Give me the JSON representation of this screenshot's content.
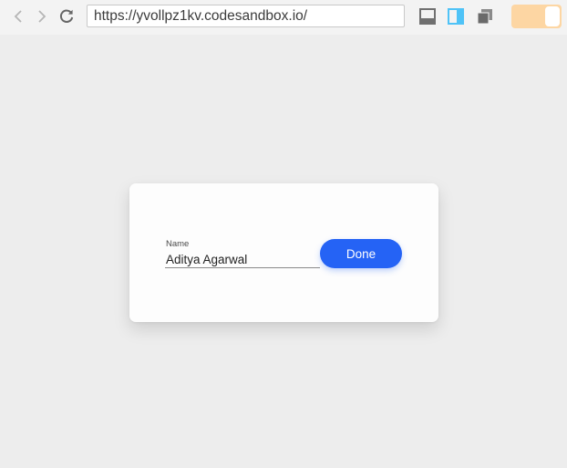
{
  "browser": {
    "url": "https://yvollpz1kv.codesandbox.io/",
    "back_icon": "chevron-left-icon",
    "forward_icon": "chevron-right-icon",
    "reload_icon": "reload-icon",
    "layout_icons": [
      "layout-bottom-panel-icon",
      "layout-side-panel-icon",
      "layout-windows-icon"
    ],
    "toggle_color": "#fdd6a3",
    "side_panel_accent": "#4fc3f7"
  },
  "form": {
    "name_label": "Name",
    "name_value": "Aditya Agarwal",
    "done_label": "Done",
    "accent_color": "#2563f5"
  }
}
